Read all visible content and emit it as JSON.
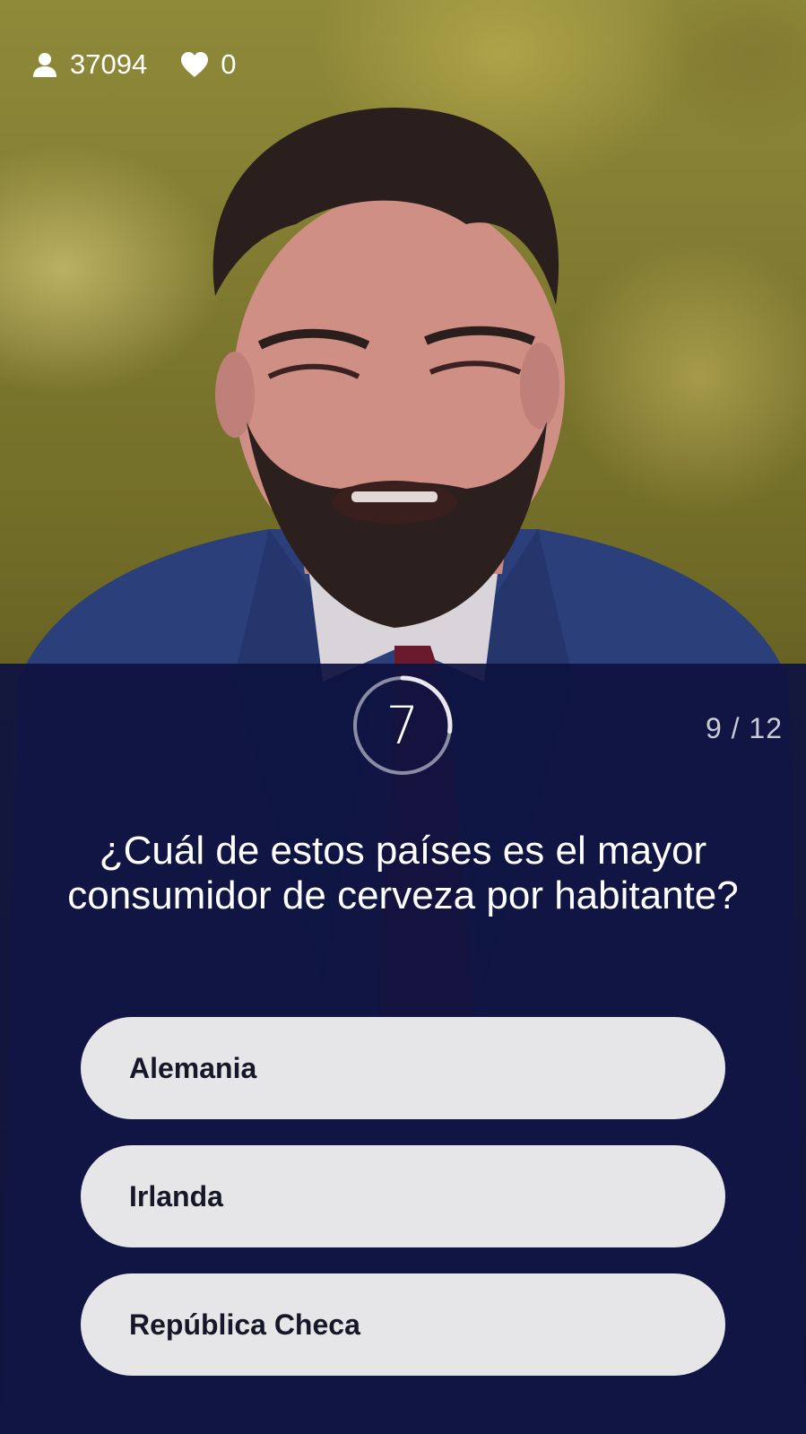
{
  "stats": {
    "viewers": "37094",
    "hearts": "0"
  },
  "quiz": {
    "timer": "7",
    "timer_progress": 0.27,
    "counter": "9 / 12",
    "question": "¿Cuál de estos países es el mayor consumidor de cerveza por habitante?",
    "answers": [
      {
        "label": "Alemania"
      },
      {
        "label": "Irlanda"
      },
      {
        "label": "República Checa"
      }
    ]
  },
  "colors": {
    "panel": "#0e1240",
    "answer_bg": "#e6e6e8",
    "answer_text": "#17172a",
    "timer_ring": "#8a8ca6",
    "timer_progress": "#e8e8ee"
  },
  "icons": {
    "viewers": "person-icon",
    "hearts": "heart-icon"
  }
}
